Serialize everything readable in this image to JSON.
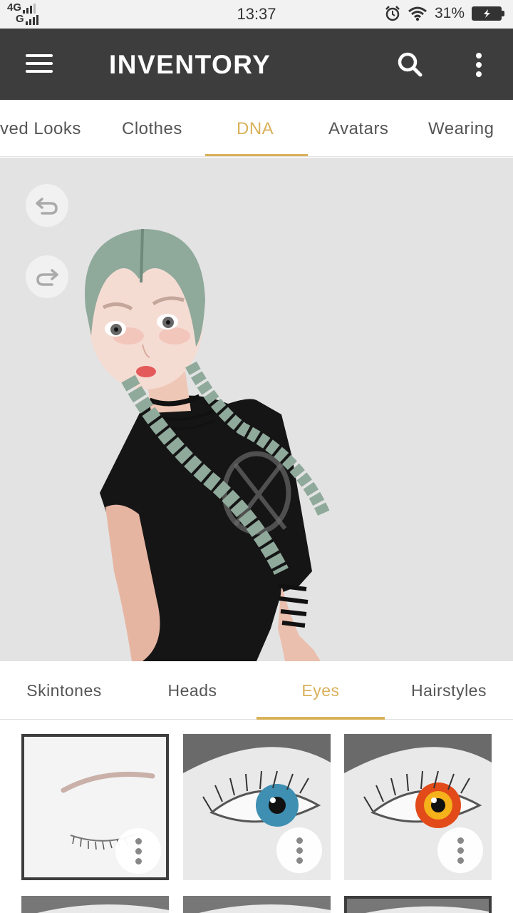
{
  "status_bar": {
    "network_top": "4G",
    "network_bottom": "G",
    "time": "13:37",
    "battery": "31%"
  },
  "app_bar": {
    "title": "INVENTORY",
    "icons": [
      "menu-icon",
      "search-icon",
      "more-vertical-icon"
    ]
  },
  "top_tabs": [
    {
      "label": "ved Looks"
    },
    {
      "label": "Clothes"
    },
    {
      "label": "DNA",
      "active": true
    },
    {
      "label": "Avatars"
    },
    {
      "label": "Wearing"
    }
  ],
  "stage": {
    "controls": [
      "undo-icon",
      "redo-icon"
    ]
  },
  "sub_tabs": [
    {
      "label": "Skintones"
    },
    {
      "label": "Heads"
    },
    {
      "label": "Eyes",
      "active": true
    },
    {
      "label": "Hairstyles"
    }
  ],
  "eye_options": [
    {
      "kind": "closed-eye",
      "selected": true
    },
    {
      "kind": "iris",
      "iris_color": "#3f8fb3"
    },
    {
      "kind": "iris",
      "iris_color": "#e24a1a"
    }
  ],
  "colors": {
    "accent": "#d9b15a",
    "app_bar": "#3d3d3d",
    "stage_bg": "#e3e3e3"
  }
}
